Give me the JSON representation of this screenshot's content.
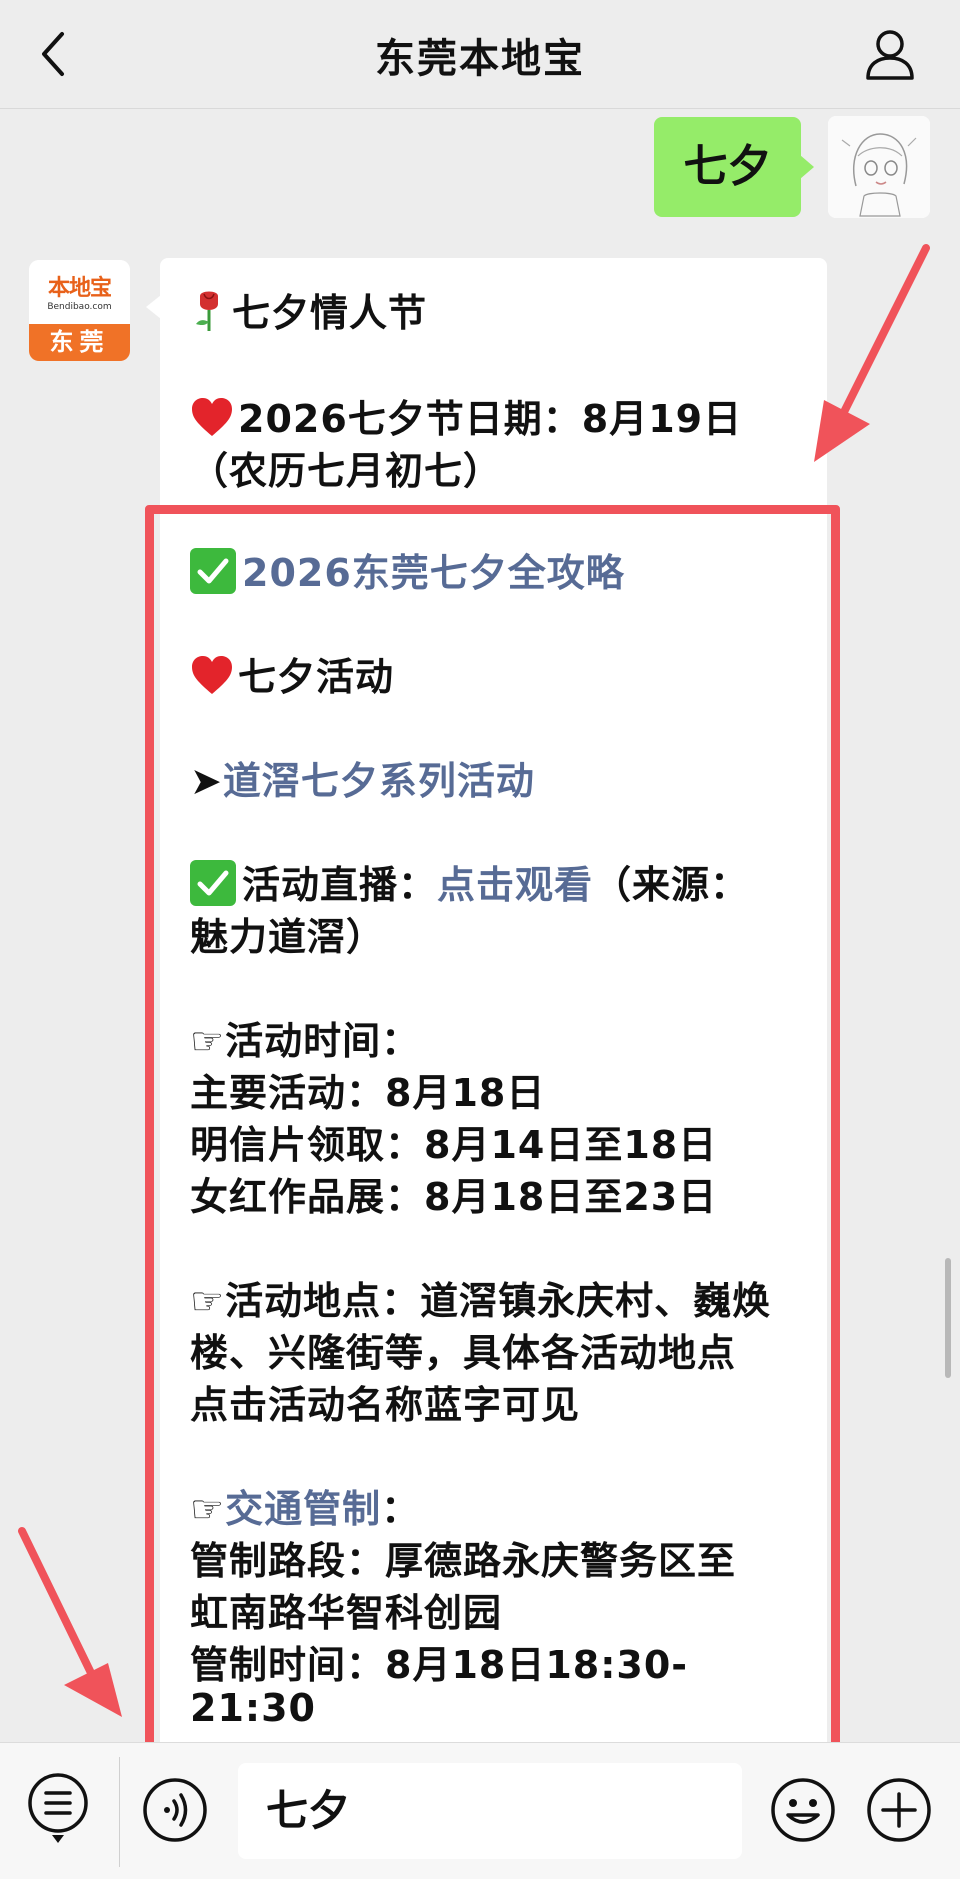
{
  "header": {
    "title": "东莞本地宝"
  },
  "sent": {
    "text": "七夕"
  },
  "brand": {
    "logo_text": "本地宝",
    "logo_sub": "Bendibao.com",
    "city": "东莞"
  },
  "message": {
    "l1": "七夕情人节",
    "l2": "2026七夕节日期：8月19日",
    "l3": "（农历七月初七）",
    "l4": "2026东莞七夕全攻略",
    "l5": "七夕活动",
    "l6_prefix": "➤",
    "l6_link": "道滘七夕系列活动",
    "l7_prefix": "活动直播：",
    "l7_link": "点击观看",
    "l7_suffix": "（来源：",
    "l8": "魅力道滘）",
    "l9": "☞活动时间：",
    "l10": "主要活动：8月18日",
    "l11": "明信片领取：8月14日至18日",
    "l12": "女红作品展：8月18日至23日",
    "l13": "☞活动地点：道滘镇永庆村、巍焕",
    "l14": "楼、兴隆街等，具体各活动地点",
    "l15": "点击活动名称蓝字可见",
    "l16_prefix": "☞",
    "l16_link": "交通管制",
    "l16_suffix": "：",
    "l17": "管制路段：厚德路永庆警务区至",
    "l18": "虹南路华智科创园",
    "l19": "管制时间：8月18日18:30-",
    "l20": "21:30"
  },
  "input": {
    "text": "七夕"
  },
  "colors": {
    "bubble_sent": "#95ec69",
    "link": "#576b95",
    "highlight": "#f0535a",
    "brand_orange": "#f07227"
  },
  "icons": [
    "back-icon",
    "profile-icon",
    "rose-icon",
    "heart-icon",
    "check-icon",
    "menu-icon",
    "voice-icon",
    "emoji-icon",
    "plus-icon",
    "arrow-icon"
  ]
}
